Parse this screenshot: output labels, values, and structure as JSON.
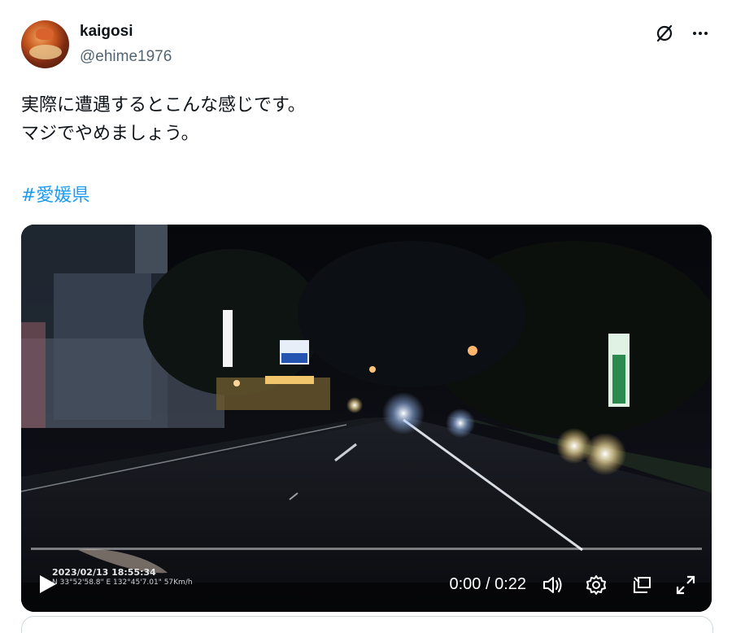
{
  "user": {
    "display_name": "kaigosi",
    "handle": "@ehime1976"
  },
  "header_icons": [
    "grok-slash-icon",
    "more-options-icon"
  ],
  "tweet": {
    "lines": [
      "実際に遭遇するとこんな感じです。",
      "マジでやめましょう。"
    ],
    "hashtag": "#愛媛県"
  },
  "video": {
    "overlay_timestamp": "2023/02/13 18:55:34",
    "overlay_gps": "N 33°52'58.8\"  E  132°45'7.01\"  57Km/h",
    "progress": 0,
    "current_time": "0:00",
    "duration": "0:22",
    "time_display": "0:00 / 0:22",
    "controls": [
      "play-icon",
      "volume-icon",
      "settings-icon",
      "pip-icon",
      "fullscreen-icon"
    ]
  },
  "colors": {
    "link": "#1d9bf0",
    "text": "#0f1419",
    "secondary": "#536471"
  }
}
